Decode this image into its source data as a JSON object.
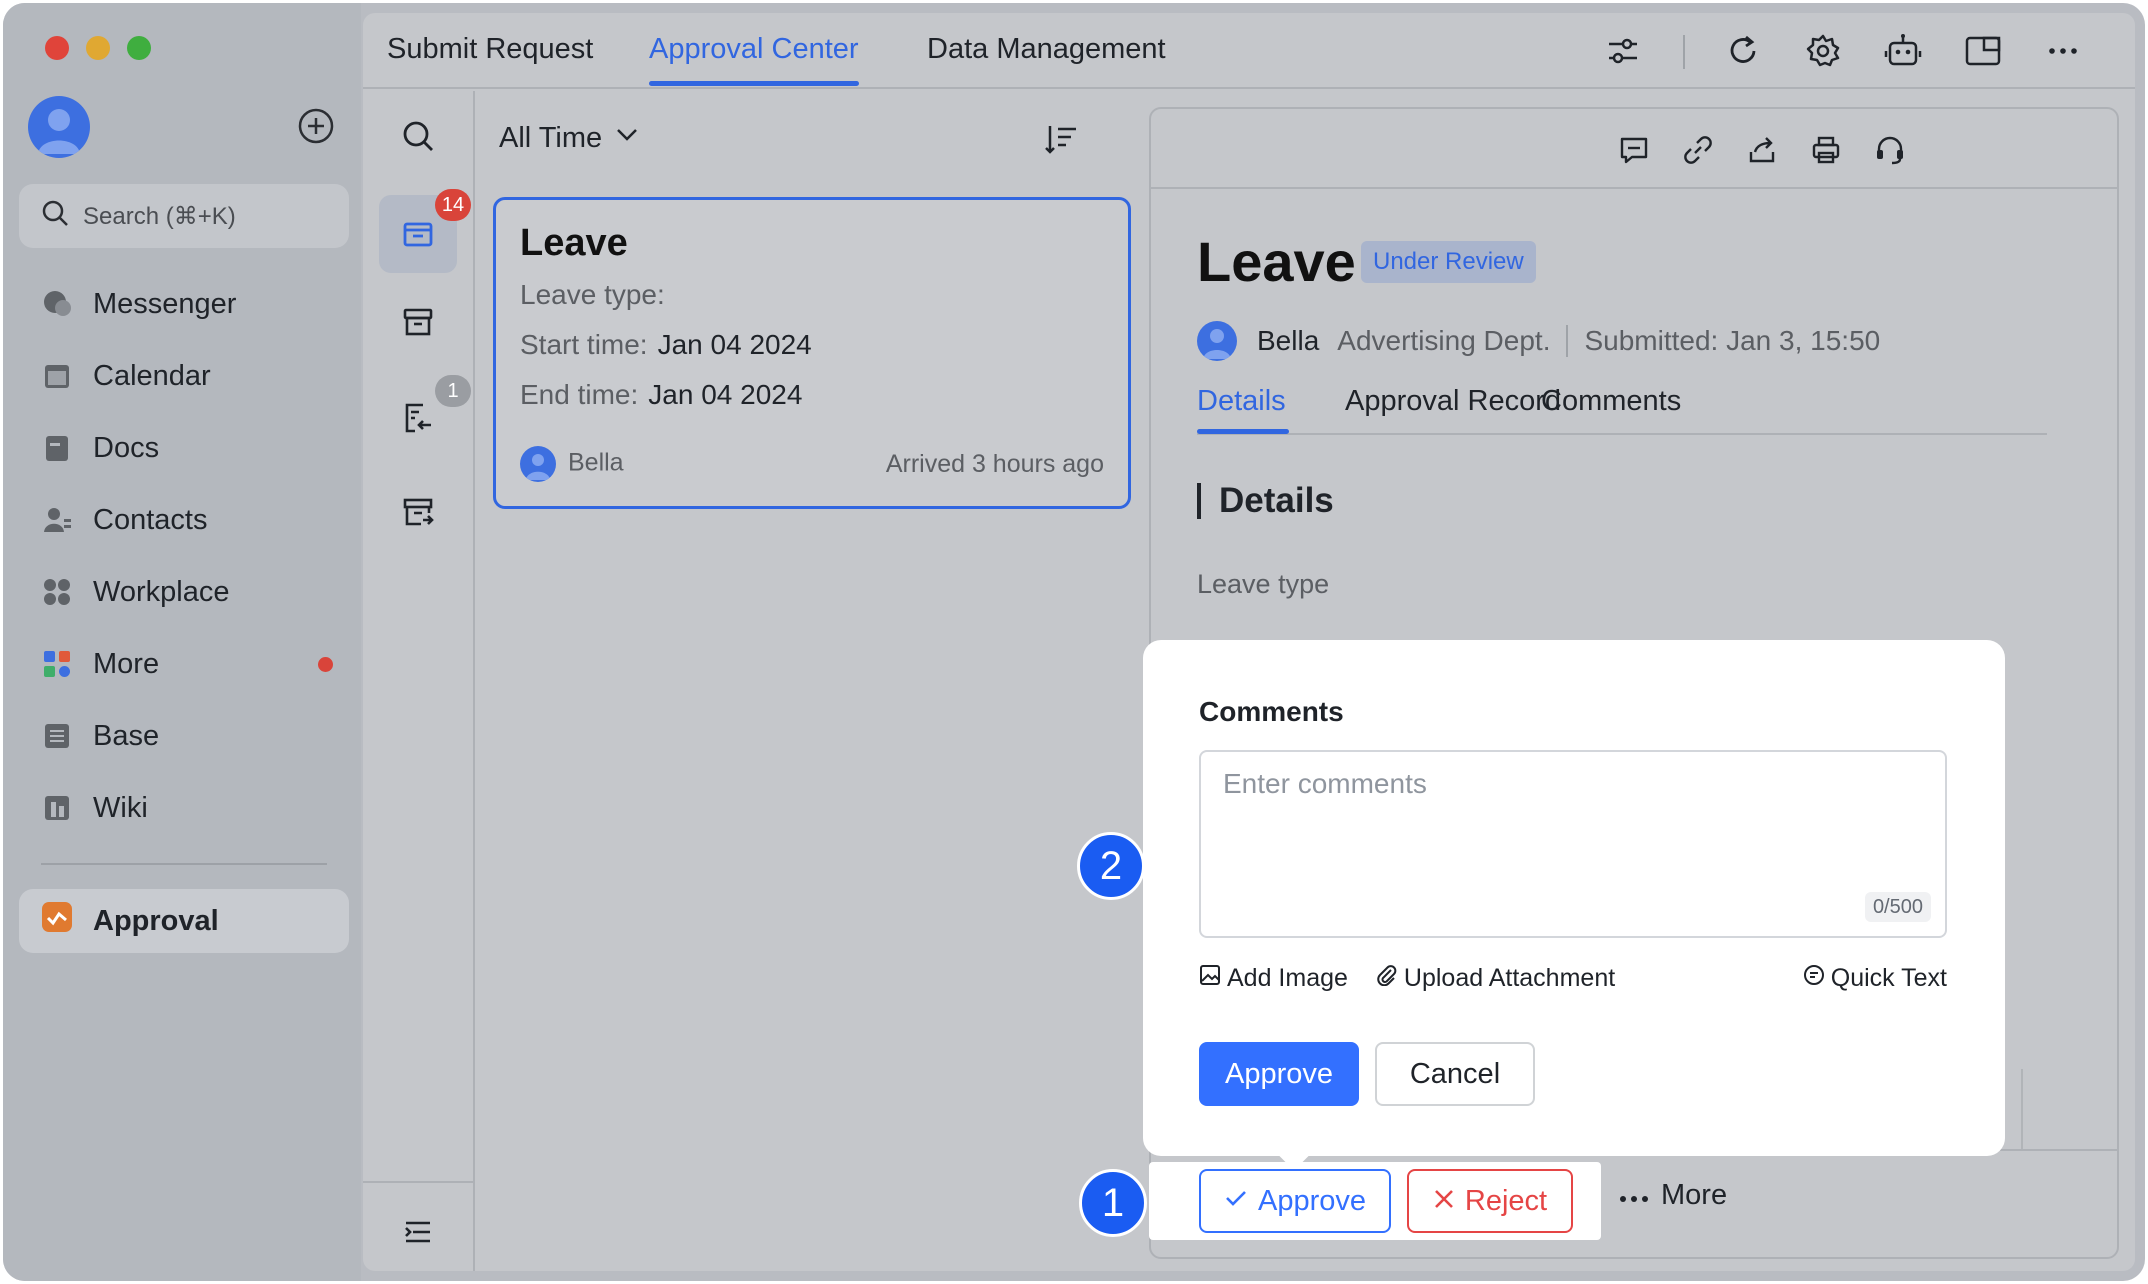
{
  "colors": {
    "accent": "#3166e0",
    "primary_button": "#3370ff",
    "danger": "#e54545",
    "badge_red": "#d9443a",
    "step_marker": "#1a5cf2"
  },
  "sidebar": {
    "search_placeholder": "Search (⌘+K)",
    "items": [
      {
        "label": "Messenger",
        "icon": "messenger-icon"
      },
      {
        "label": "Calendar",
        "icon": "calendar-icon"
      },
      {
        "label": "Docs",
        "icon": "docs-icon"
      },
      {
        "label": "Contacts",
        "icon": "contacts-icon"
      },
      {
        "label": "Workplace",
        "icon": "workplace-icon"
      },
      {
        "label": "More",
        "icon": "more-apps-icon"
      },
      {
        "label": "Base",
        "icon": "base-icon"
      },
      {
        "label": "Wiki",
        "icon": "wiki-icon"
      }
    ],
    "active_app": {
      "label": "Approval",
      "icon": "approval-app-icon"
    }
  },
  "topbar": {
    "tabs": [
      {
        "label": "Submit Request"
      },
      {
        "label": "Approval Center"
      },
      {
        "label": "Data Management"
      }
    ]
  },
  "rail": {
    "pending_badge": "14",
    "transferred_badge": "1"
  },
  "list": {
    "filter_label": "All Time",
    "card": {
      "title": "Leave",
      "leave_type_label": "Leave type:",
      "start_label": "Start time:",
      "start_value": "Jan 04 2024",
      "end_label": "End time:",
      "end_value": "Jan 04 2024",
      "requester": "Bella",
      "arrived": "Arrived 3 hours ago"
    }
  },
  "detail": {
    "title": "Leave",
    "status": "Under Review",
    "requester": "Bella",
    "department": "Advertising Dept.",
    "submitted": "Submitted:  Jan 3, 15:50",
    "tabs": [
      {
        "label": "Details"
      },
      {
        "label": "Approval Record"
      },
      {
        "label": "Comments"
      }
    ],
    "section_title": "Details",
    "leave_type_label": "Leave type"
  },
  "popup": {
    "label": "Comments",
    "placeholder": "Enter comments",
    "counter": "0/500",
    "add_image": "Add Image",
    "upload_attachment": "Upload Attachment",
    "quick_text": "Quick Text",
    "approve": "Approve",
    "cancel": "Cancel"
  },
  "actions": {
    "approve": "Approve",
    "reject": "Reject",
    "more": "More"
  },
  "steps": {
    "one": "1",
    "two": "2"
  }
}
